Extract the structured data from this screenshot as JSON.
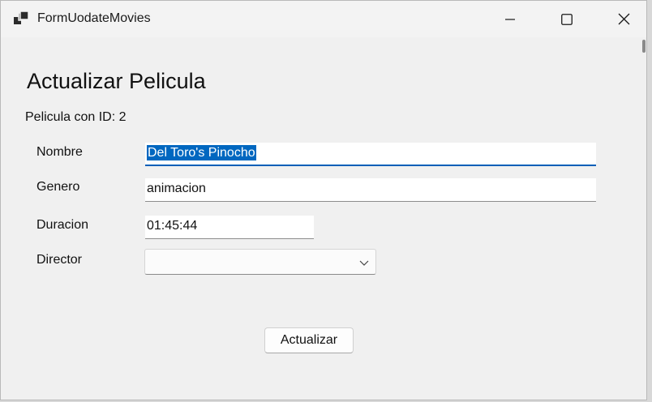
{
  "window": {
    "title": "FormUodateMovies",
    "icon": "app-window-icon"
  },
  "caption_buttons": {
    "minimize_icon": "minimize-icon",
    "maximize_icon": "maximize-icon",
    "close_icon": "close-icon"
  },
  "form": {
    "heading": "Actualizar Pelicula",
    "id_label": "Pelicula con ID: 2",
    "fields": {
      "nombre": {
        "label": "Nombre",
        "value": "Del Toro's Pinocho",
        "selected": true
      },
      "genero": {
        "label": "Genero",
        "value": "animacion"
      },
      "duracion": {
        "label": "Duracion",
        "value": "01:45:44"
      },
      "director": {
        "label": "Director",
        "value": ""
      }
    },
    "submit_label": "Actualizar"
  },
  "colors": {
    "background": "#f0f0f0",
    "focus_accent": "#005fb8",
    "selection": "#0067c0"
  }
}
